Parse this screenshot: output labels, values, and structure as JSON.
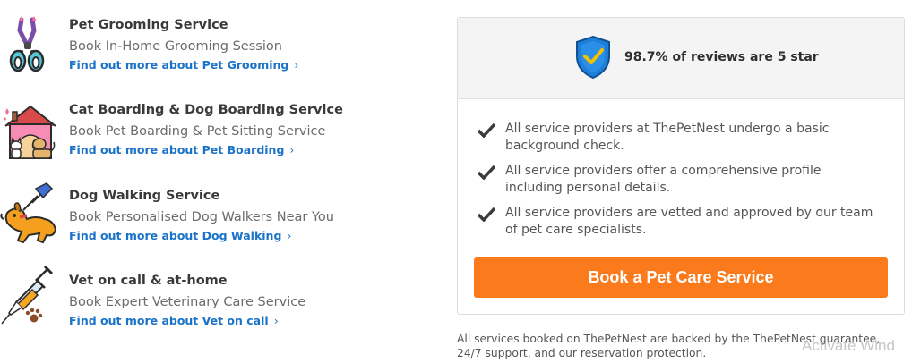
{
  "services": [
    {
      "title": "Pet Grooming Service",
      "subtitle": "Book In-Home Grooming Session",
      "link": "Find out more about Pet Grooming",
      "icon": "scissors-icon"
    },
    {
      "title": "Cat Boarding & Dog Boarding Service",
      "subtitle": "Book Pet Boarding & Pet Sitting Service",
      "link": "Find out more about Pet Boarding",
      "icon": "pet-house-icon"
    },
    {
      "title": "Dog Walking Service",
      "subtitle": "Book Personalised Dog Walkers Near You",
      "link": "Find out more about Dog Walking",
      "icon": "dog-walking-icon"
    },
    {
      "title": "Vet on call & at-home",
      "subtitle": "Book Expert Veterinary Care Service",
      "link": "Find out more about Vet on call",
      "icon": "syringe-icon"
    }
  ],
  "link_chevron": "›",
  "panel": {
    "rating_text": "98.7% of reviews are 5 star",
    "checks": [
      "All service providers at ThePetNest undergo a basic background check.",
      "All service providers offer a comprehensive profile including personal details.",
      "All service providers are vetted and approved by our team of pet care specialists."
    ],
    "button_label": "Book a Pet Care Service"
  },
  "guarantee_text": "All services booked on ThePetNest are backed by the ThePetNest guarantee, 24/7 support, and our reservation protection.",
  "watermark": "Activate Wind",
  "colors": {
    "link": "#1a73c8",
    "button": "#fb7a1b",
    "shield": "#1e7fd8",
    "check": "#f2c200"
  }
}
